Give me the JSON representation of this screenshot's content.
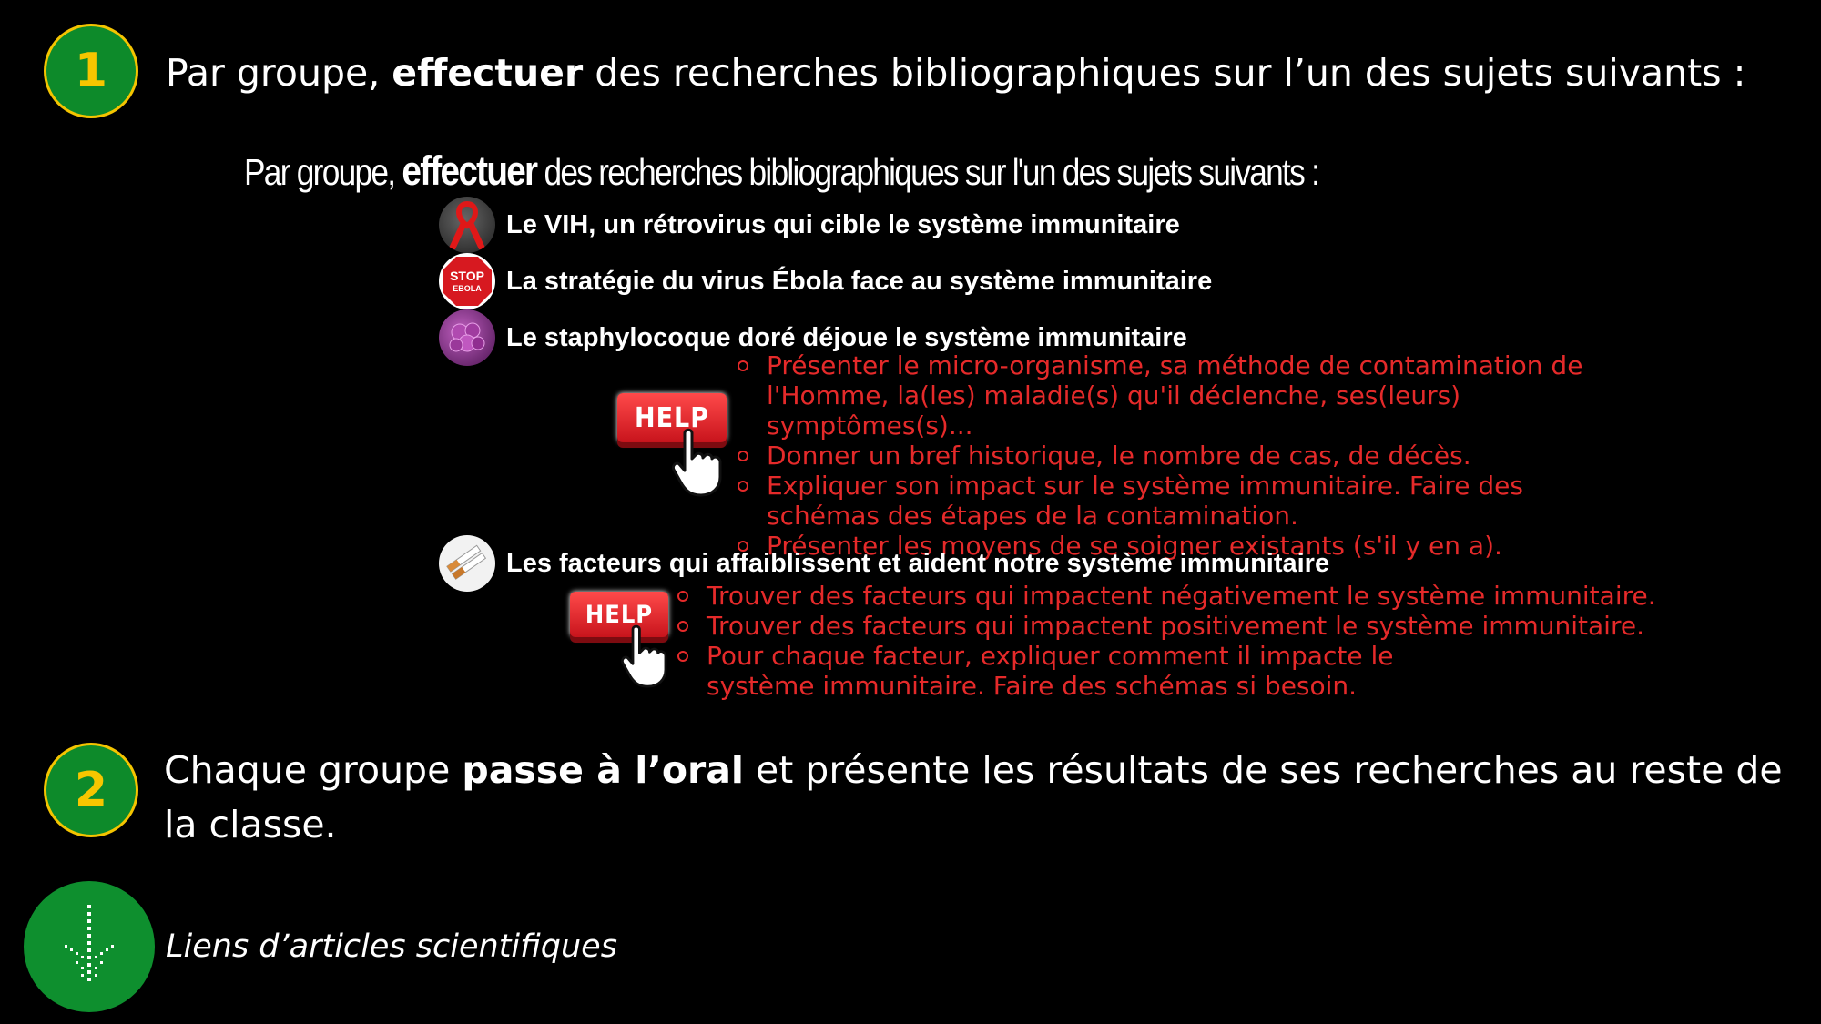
{
  "step1": {
    "number": "1",
    "text_before": "Par groupe, ",
    "text_bold": "effectuer",
    "text_after": " des recherches bibliographiques sur l’un des sujets suivants :"
  },
  "image_block": {
    "subtitle_before": "Par groupe, ",
    "subtitle_bold": "effectuer",
    "subtitle_after": " des recherches bibliographiques sur l'un des sujets suivants :",
    "stop_sign_top": "STOP",
    "stop_sign_bottom": "EBOLA",
    "topics": [
      {
        "title": "Le VIH, un rétrovirus qui cible le système immunitaire",
        "icon": "red-ribbon-icon"
      },
      {
        "title": "La stratégie du virus Ébola face au système immunitaire",
        "icon": "stop-ebola-icon"
      },
      {
        "title": "Le staphylocoque doré déjoue le système immunitaire",
        "icon": "bacteria-icon"
      },
      {
        "title": "Les facteurs qui affaiblissent et aident notre système immunitaire",
        "icon": "cigarettes-icon"
      }
    ],
    "help_label": "HELP",
    "help1_bullets": [
      "Présenter le micro-organisme, sa méthode de contamination de l'Homme, la(les) maladie(s) qu'il déclenche, ses(leurs) symptômes(s)...",
      "Donner un bref historique, le nombre de cas, de décès.",
      "Expliquer son impact sur le système immunitaire. Faire des schémas des étapes de la contamination.",
      "Présenter les moyens de se soigner existants (s'il y en a)."
    ],
    "help2_bullets": [
      "Trouver des facteurs qui impactent négativement le système immunitaire.",
      "Trouver des facteurs qui impactent positivement le système immunitaire.",
      "Pour chaque facteur, expliquer comment il impacte le système immunitaire. Faire des schémas si besoin."
    ]
  },
  "step2": {
    "number": "2",
    "text_before": "Chaque groupe ",
    "text_bold": "passe à l’oral",
    "text_after": " et présente les résultats de ses recherches au reste de la classe."
  },
  "links": {
    "label": "Liens d’articles scientifiques",
    "icon": "download-arrow-icon"
  },
  "colors": {
    "badge_green": "#0d8a2a",
    "badge_number": "#f7c600",
    "bullet_red": "#e52a2a"
  }
}
